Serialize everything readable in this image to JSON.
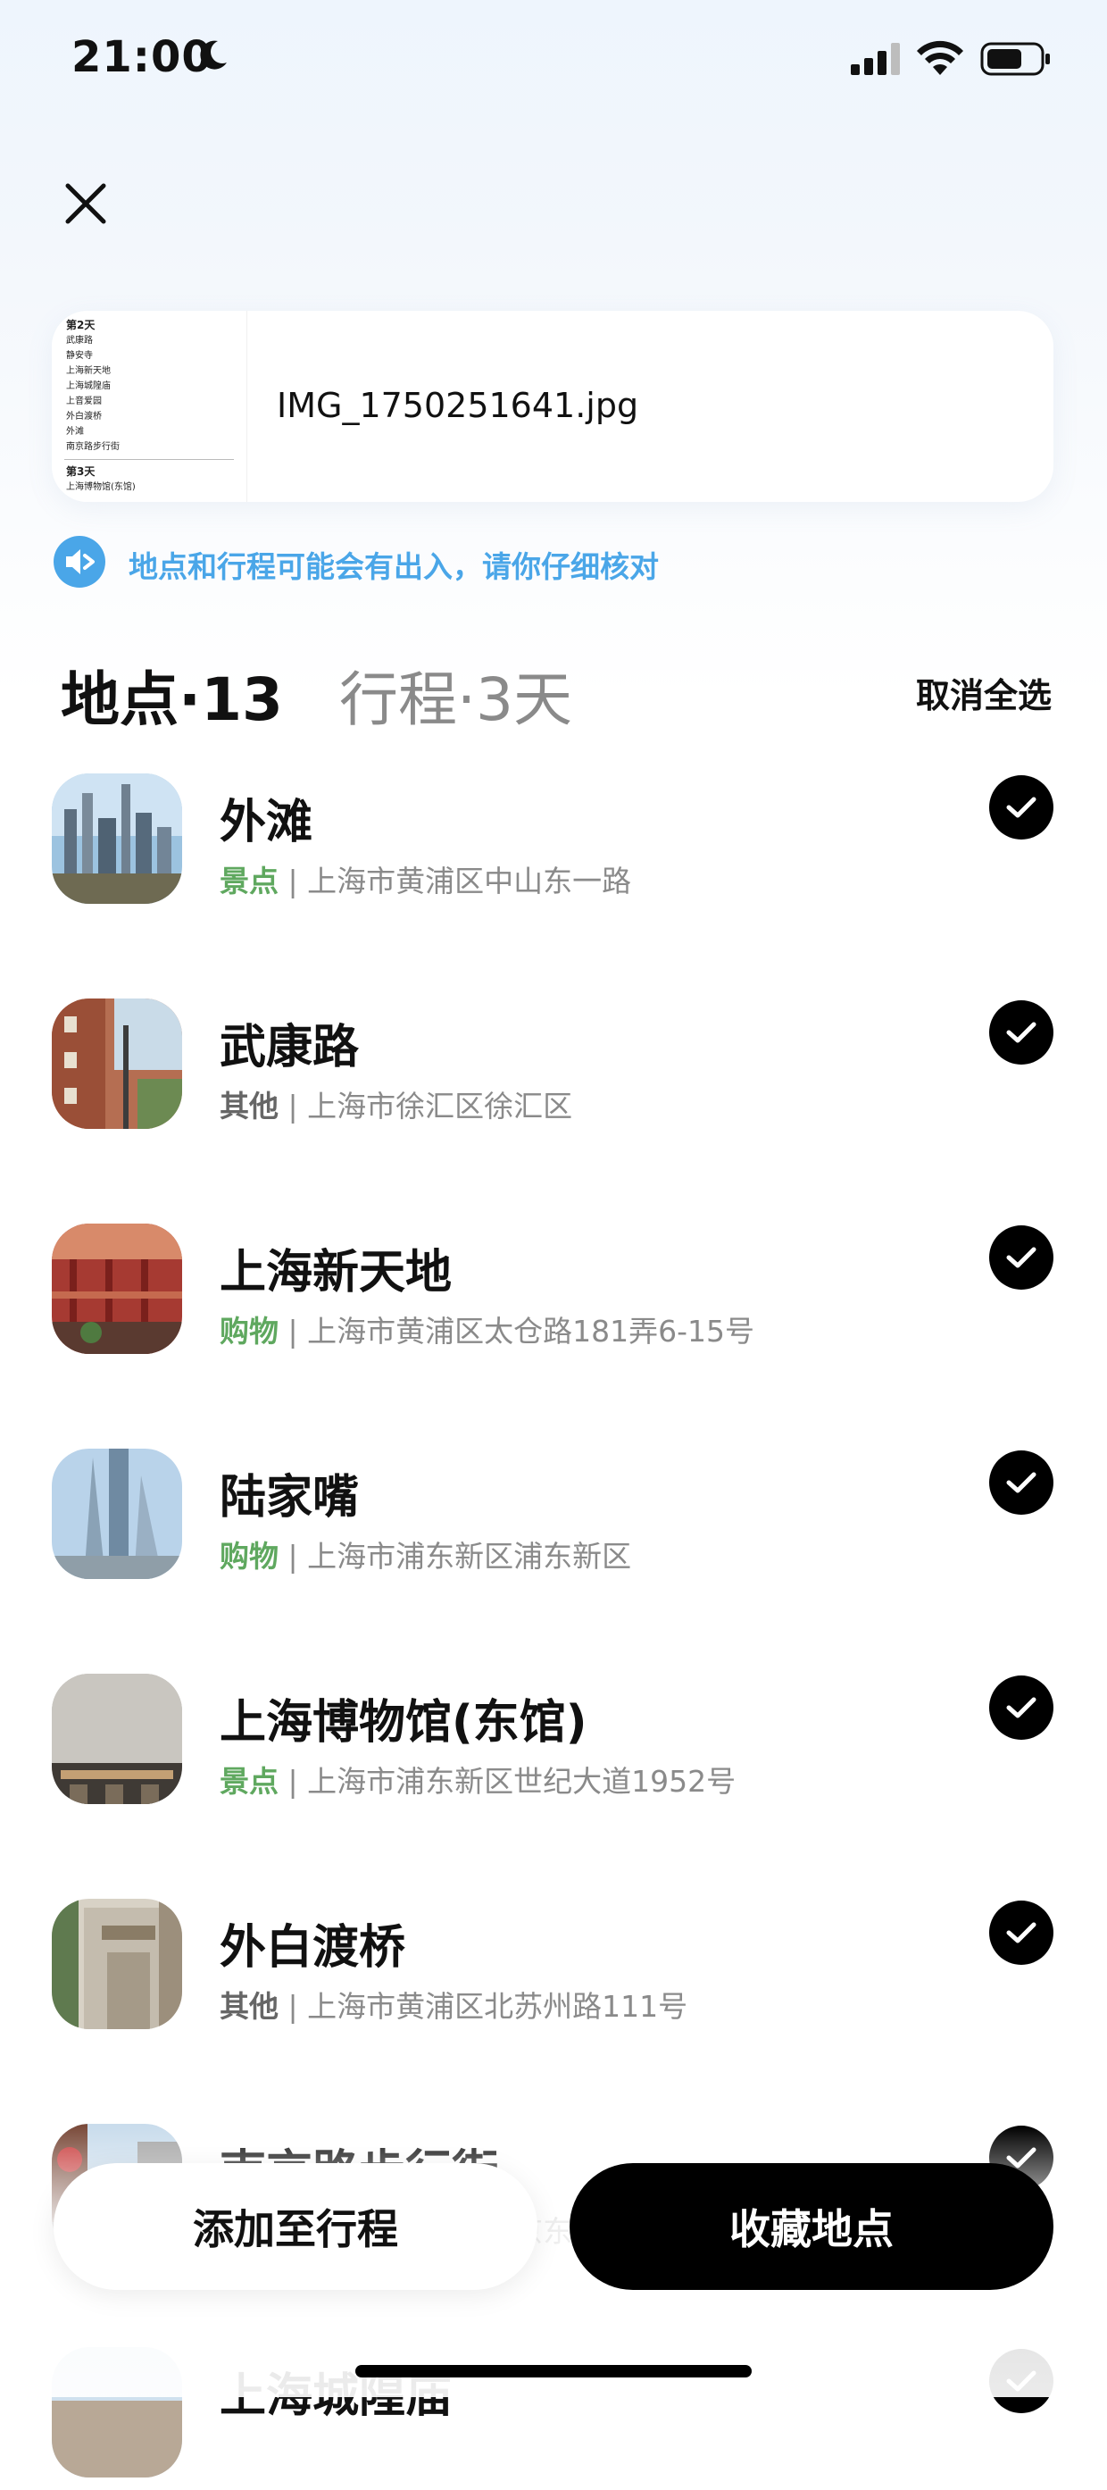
{
  "status_bar": {
    "time": "21:00"
  },
  "file": {
    "name": "IMG_1750251641.jpg",
    "thumbnail_lines": [
      "第2天",
      "武康路",
      "静安寺",
      "上海新天地",
      "上海城隍庙",
      "上音爱园",
      "外白渡桥",
      "外滩",
      "南京路步行街",
      "第3天",
      "上海博物馆(东馆)"
    ]
  },
  "notice": {
    "text": "地点和行程可能会有出入，请你仔细核对"
  },
  "tabs": {
    "places": "地点·13",
    "itinerary": "行程·3天",
    "deselect_all": "取消全选"
  },
  "places": [
    {
      "name": "外滩",
      "category": "景点",
      "address": " | 上海市黄浦区中山东一路",
      "cat_color": "#5fa85f"
    },
    {
      "name": "武康路",
      "category": "其他",
      "address": " | 上海市徐汇区徐汇区",
      "cat_color": "#666666"
    },
    {
      "name": "上海新天地",
      "category": "购物",
      "address": " | 上海市黄浦区太仓路181弄6-15号",
      "cat_color": "#5fa85f"
    },
    {
      "name": "陆家嘴",
      "category": "购物",
      "address": " | 上海市浦东新区浦东新区",
      "cat_color": "#5fa85f"
    },
    {
      "name": "上海博物馆(东馆)",
      "category": "景点",
      "address": " | 上海市浦东新区世纪大道1952号",
      "cat_color": "#5fa85f"
    },
    {
      "name": "外白渡桥",
      "category": "其他",
      "address": " | 上海市黄浦区北苏州路111号",
      "cat_color": "#666666"
    },
    {
      "name": "南京路步行街",
      "category": "景点",
      "address": " | 上海市黄浦区南京东路",
      "cat_color": "#5fa85f"
    },
    {
      "name": "上海城隍庙",
      "category": "",
      "address": "",
      "cat_color": "#5fa85f"
    }
  ],
  "actions": {
    "add_to_itinerary": "添加至行程",
    "save_places": "收藏地点"
  },
  "colors": {
    "accent_blue": "#4aa6e8",
    "category_green": "#5fa85f"
  }
}
